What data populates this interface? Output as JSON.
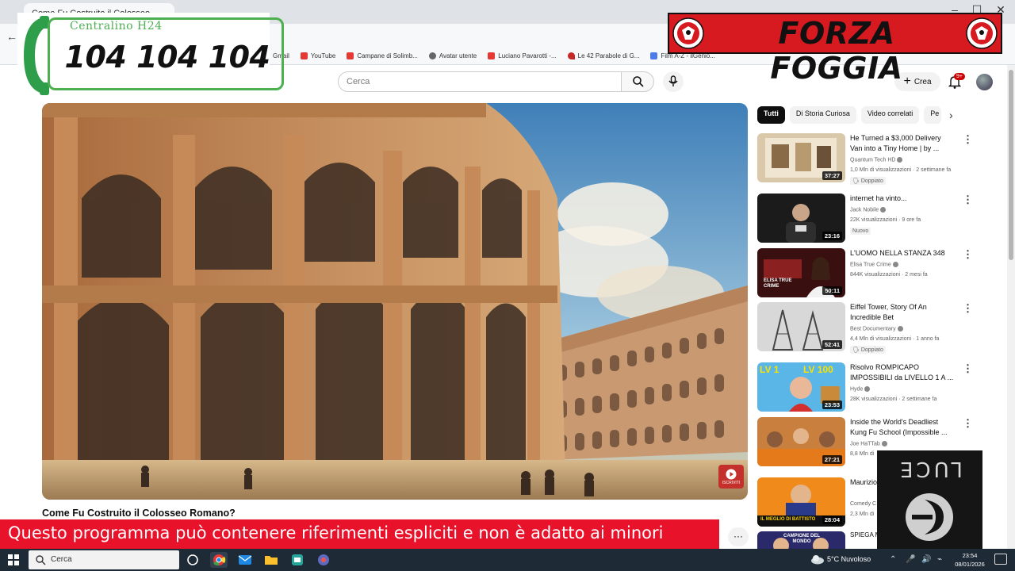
{
  "browser": {
    "tab_title": "Come Fu Costruito il Colosseo...",
    "bookmarks": [
      {
        "label": "Gmail",
        "icon": "gmail-icon"
      },
      {
        "label": "YouTube",
        "icon": "youtube-icon"
      },
      {
        "label": "Campane di Solimb...",
        "icon": "youtube-icon"
      },
      {
        "label": "Avatar utente",
        "icon": "globe-icon"
      },
      {
        "label": "Luciano Pavarotti -...",
        "icon": "youtube-icon"
      },
      {
        "label": "Le 42 Parabole di G...",
        "icon": "heart-icon"
      },
      {
        "label": "Film A-Z - ilGenio...",
        "icon": "film-icon"
      }
    ]
  },
  "youtube": {
    "search_placeholder": "Cerca",
    "create_label": "Crea",
    "notification_count": "9+",
    "video_title": "Come Fu Costruito il Colosseo Romano?",
    "subscribe_label": "ISCRIVITI",
    "more_label": "···",
    "chips": [
      "Tutti",
      "Di Storia Curiosa",
      "Video correlati",
      "Pe"
    ],
    "recommendations": [
      {
        "title": "He Turned a $3,000 Delivery Van into a Tiny Home | by ...",
        "channel": "Quantum Tech HD",
        "meta": "1,0 Mln di visualizzazioni · 2 settimane fa",
        "badge": "Doppiato",
        "duration": "37:27"
      },
      {
        "title": "internet ha vinto...",
        "channel": "Jack Nobile",
        "meta": "22K visualizzazioni · 9 ore fa",
        "badge": "Nuovo",
        "duration": "23:16"
      },
      {
        "title": "L'UOMO NELLA STANZA 348",
        "channel": "Elisa True Crime",
        "meta": "844K visualizzazioni · 2 mesi fa",
        "badge": "",
        "duration": "50:11"
      },
      {
        "title": "Eiffel Tower, Story Of An Incredible Bet",
        "channel": "Best Documentary",
        "meta": "4,4 Mln di visualizzazioni · 1 anno fa",
        "badge": "Doppiato",
        "duration": "52:41"
      },
      {
        "title": "Risolvo ROMPICAPO IMPOSSIBILI da LIVELLO 1 A ...",
        "channel": "Hyde",
        "meta": "28K visualizzazioni · 2 settimane fa",
        "badge": "",
        "duration": "23:53"
      },
      {
        "title": "Inside the World's Deadliest Kung Fu School (Impossible ...",
        "channel": "Joe HaTTab",
        "meta": "8,8 Mln di",
        "badge": "",
        "duration": "27:21"
      },
      {
        "title": "Maurizio Battisto",
        "channel": "Comedy C",
        "meta": "2,3 Mln di",
        "badge": "",
        "duration": "28:04"
      },
      {
        "title": "SPIEGA MAGIE",
        "channel": "",
        "meta": "",
        "badge": "",
        "duration": ""
      }
    ],
    "thumb_texts": {
      "elisa": "ELISA TRUE CRIME",
      "lv1": "LV 1",
      "lv100": "LV 100",
      "battisto": "IL MEGLIO DI BATTISTO",
      "campione": "CAMPIONE DEL MONDO"
    }
  },
  "overlays": {
    "phone_caption": "Centralino H24",
    "phone_number": "104 104 104",
    "forza": "FORZA FOGGIA",
    "warning": "Questo programma  può contenere riferimenti espliciti e non è adatto ai minori",
    "luce": "LUCE"
  },
  "taskbar": {
    "search_label": "Cerca",
    "weather": "5°C  Nuvoloso",
    "time": "23:54",
    "date": "08/01/2026"
  },
  "colors": {
    "youtube_red": "#cc0000",
    "phone_green": "#4caf50",
    "forza_red": "#d71920",
    "warning_red": "#e8122a"
  }
}
